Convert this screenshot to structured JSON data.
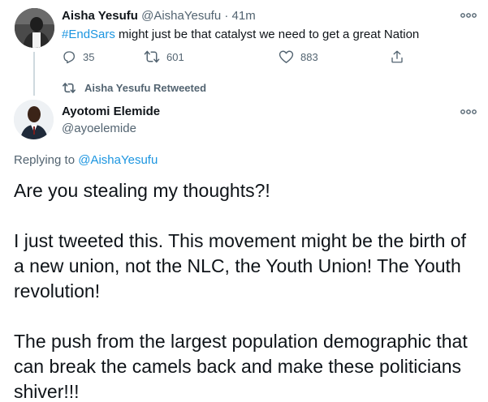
{
  "tweet1": {
    "name": "Aisha Yesufu",
    "handle": "@AishaYesufu",
    "separator": " · ",
    "time": "41m",
    "hashtag": "#EndSars",
    "text_rest": " might just be that catalyst we need to get a great Nation",
    "replies": "35",
    "retweets": "601",
    "likes": "883"
  },
  "retweet_banner": "Aisha Yesufu Retweeted",
  "tweet2": {
    "name": "Ayotomi Elemide",
    "handle": "@ayoelemide",
    "replying_prefix": "Replying to ",
    "replying_handle": "@AishaYesufu",
    "para1": "Are you stealing my thoughts?!",
    "para2": "I just tweeted this. This movement might be the birth of a new union, not the NLC, the Youth Union! The Youth revolution!",
    "para3": "The push from the largest population demographic that can break the camels back and make these politicians shiver!!!"
  },
  "colors": {
    "link": "#1b95e0",
    "muted": "#536471",
    "text": "#0f1419"
  },
  "icons": {
    "reply": "reply-icon",
    "retweet": "retweet-icon",
    "like": "heart-icon",
    "share": "share-icon",
    "more": "more-icon"
  }
}
